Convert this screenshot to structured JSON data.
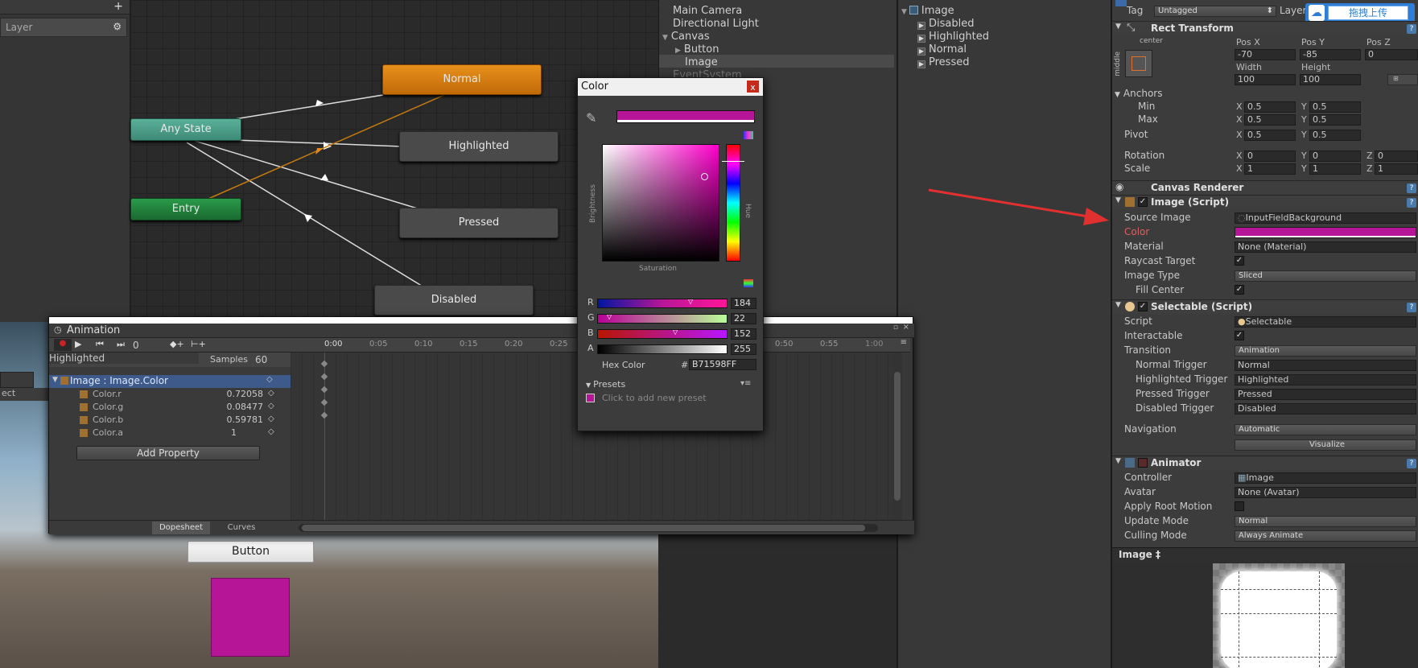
{
  "colors": {
    "accent": "#B71598",
    "orange_node": "#d97a10",
    "teal_node": "#4aa08a",
    "green_node": "#1e7a3a",
    "red_arrow": "#e03030"
  },
  "animator_left": {
    "layer_label": "Layer",
    "add_icon": "plus-icon",
    "gear_icon": "gear-icon"
  },
  "animator_graph": {
    "nodes": {
      "normal": "Normal",
      "any_state": "Any State",
      "highlighted": "Highlighted",
      "entry": "Entry",
      "pressed": "Pressed",
      "disabled": "Disabled"
    }
  },
  "hierarchy": {
    "items": [
      "Main Camera",
      "Directional Light",
      "Canvas",
      "Button",
      "Image",
      "EventSystem"
    ]
  },
  "anim_tree": {
    "root": "Image",
    "children": [
      "Disabled",
      "Highlighted",
      "Normal",
      "Pressed"
    ]
  },
  "inspector": {
    "tag_label": "Tag",
    "tag_value": "Untagged",
    "layer_label": "Layer",
    "upload_button": "拖拽上传",
    "rect_transform": {
      "title": "Rect Transform",
      "anchor_preset": "center",
      "anchor_side": "middle",
      "posx_label": "Pos X",
      "posy_label": "Pos Y",
      "posz_label": "Pos Z",
      "posx": "-70",
      "posy": "-85",
      "posz": "0",
      "width_label": "Width",
      "height_label": "Height",
      "width": "100",
      "height": "100",
      "anchors_label": "Anchors",
      "min_label": "Min",
      "max_label": "Max",
      "pivot_label": "Pivot",
      "min_x": "0.5",
      "min_y": "0.5",
      "max_x": "0.5",
      "max_y": "0.5",
      "pivot_x": "0.5",
      "pivot_y": "0.5",
      "rotation_label": "Rotation",
      "scale_label": "Scale",
      "rot_x": "0",
      "rot_y": "0",
      "rot_z": "0",
      "scale_x": "1",
      "scale_y": "1",
      "scale_z": "1",
      "x": "X",
      "y": "Y",
      "z": "Z"
    },
    "canvas_renderer": {
      "title": "Canvas Renderer"
    },
    "image_script": {
      "title": "Image (Script)",
      "source_image_label": "Source Image",
      "source_image": "InputFieldBackground",
      "color_label": "Color",
      "material_label": "Material",
      "material": "None (Material)",
      "raycast_label": "Raycast Target",
      "image_type_label": "Image Type",
      "image_type": "Sliced",
      "fill_center_label": "Fill Center"
    },
    "selectable": {
      "title": "Selectable (Script)",
      "script_label": "Script",
      "script": "Selectable",
      "interactable_label": "Interactable",
      "transition_label": "Transition",
      "transition": "Animation",
      "normal_trigger_label": "Normal Trigger",
      "normal_trigger": "Normal",
      "highlighted_trigger_label": "Highlighted Trigger",
      "highlighted_trigger": "Highlighted",
      "pressed_trigger_label": "Pressed Trigger",
      "pressed_trigger": "Pressed",
      "disabled_trigger_label": "Disabled Trigger",
      "disabled_trigger": "Disabled",
      "navigation_label": "Navigation",
      "navigation": "Automatic",
      "visualize": "Visualize"
    },
    "animator": {
      "title": "Animator",
      "controller_label": "Controller",
      "controller": "Image",
      "avatar_label": "Avatar",
      "avatar": "None (Avatar)",
      "apply_root_label": "Apply Root Motion",
      "update_mode_label": "Update Mode",
      "update_mode": "Normal",
      "culling_label": "Culling Mode",
      "culling": "Always Animate"
    },
    "preview_title": "Image ‡"
  },
  "scene": {
    "tab_fragment": "ect",
    "button_text": "Button"
  },
  "animation": {
    "tab": "Animation",
    "frame": "0",
    "clip": "Highlighted",
    "samples_label": "Samples",
    "samples": "60",
    "ticks": [
      "0:00",
      "0:05",
      "0:10",
      "0:15",
      "0:20",
      "0:25",
      "0:50",
      "0:55",
      "1:00"
    ],
    "property_group": "Image : Image.Color",
    "properties": [
      {
        "name": "Color.r",
        "value": "0.72058"
      },
      {
        "name": "Color.g",
        "value": "0.08477"
      },
      {
        "name": "Color.b",
        "value": "0.59781"
      },
      {
        "name": "Color.a",
        "value": "1"
      }
    ],
    "add_property": "Add Property",
    "dopesheet": "Dopesheet",
    "curves": "Curves"
  },
  "color_picker": {
    "title": "Color",
    "close": "x",
    "brightness": "Brightness",
    "saturation": "Saturation",
    "hue": "Hue",
    "r_label": "R",
    "g_label": "G",
    "b_label": "B",
    "a_label": "A",
    "r": "184",
    "g": "22",
    "b": "152",
    "a": "255",
    "hex_label": "Hex Color",
    "hash": "#",
    "hex": "B71598FF",
    "presets": "Presets",
    "add_preset": "Click to add new preset",
    "sv_marker": {
      "saturation": 0.88,
      "value": 0.72
    },
    "hue_fraction": 0.86
  }
}
